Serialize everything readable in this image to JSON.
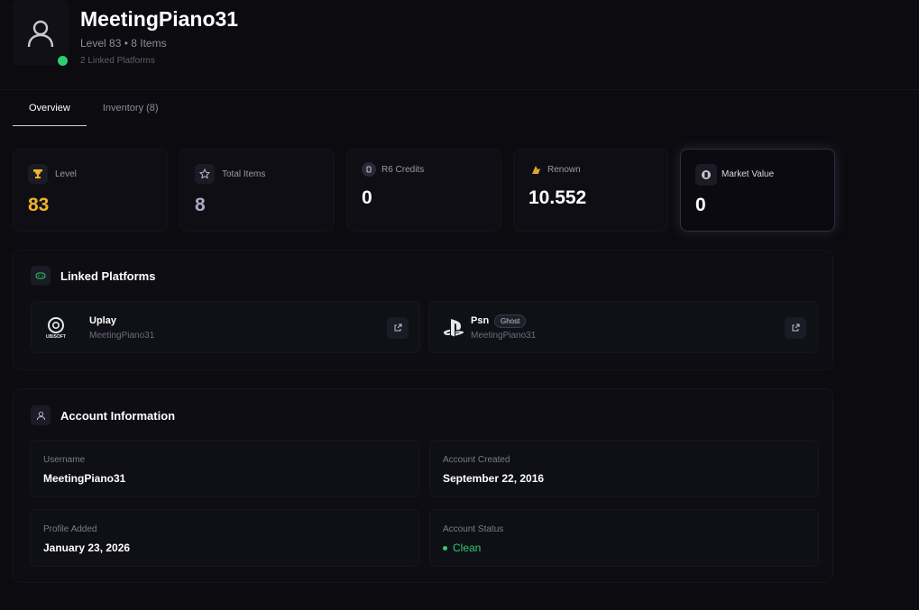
{
  "profile": {
    "username": "MeetingPiano31",
    "level_line": "Level 83 • 8 Items",
    "platforms_line": "2 Linked Platforms",
    "online_color": "#2ecc71"
  },
  "tabs": [
    {
      "label": "Overview",
      "active": true
    },
    {
      "label": "Inventory (8)",
      "active": false
    }
  ],
  "stats": [
    {
      "label": "Level",
      "value": "83",
      "icon": "trophy-icon",
      "value_color": "#f0b429"
    },
    {
      "label": "Total Items",
      "value": "8",
      "icon": "star-icon",
      "value_color": "#a9a9c4"
    },
    {
      "label": "R6 Credits",
      "value": "0",
      "icon": "credits-icon",
      "value_color": "#ffffff"
    },
    {
      "label": "Renown",
      "value": "10.552",
      "icon": "renown-icon",
      "value_color": "#ffffff"
    },
    {
      "label": "Market Value",
      "value": "0",
      "icon": "market-icon",
      "value_color": "#ffffff"
    }
  ],
  "linked_platforms": {
    "title": "Linked Platforms",
    "items": [
      {
        "name": "Uplay",
        "user": "MeetingPiano31",
        "logo": "ubisoft-logo",
        "logo_text": "UBISOFT",
        "badge": ""
      },
      {
        "name": "Psn",
        "user": "MeetingPiano31",
        "logo": "playstation-logo",
        "badge": "Ghost"
      }
    ]
  },
  "account_info": {
    "title": "Account Information",
    "fields": [
      {
        "label": "Username",
        "value": "MeetingPiano31"
      },
      {
        "label": "Account Created",
        "value": "September 22, 2016"
      },
      {
        "label": "Profile Added",
        "value": "January 23, 2026"
      },
      {
        "label": "Account Status",
        "value": "Clean",
        "color": "#2ecc71"
      }
    ]
  }
}
